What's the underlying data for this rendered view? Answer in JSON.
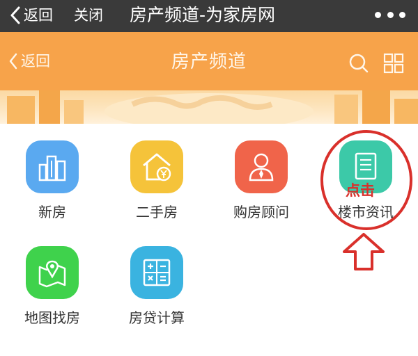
{
  "topbar": {
    "back_label": "返回",
    "close_label": "关闭",
    "title": "房产频道-为家房网",
    "more_icon": "more-dots-icon"
  },
  "header": {
    "back_label": "返回",
    "title": "房产频道",
    "search_icon": "search-icon",
    "grid_icon": "grid-icon",
    "color": "#f7a34a"
  },
  "tiles": [
    {
      "label": "新房",
      "icon": "buildings-icon",
      "color": "#5aa9f0"
    },
    {
      "label": "二手房",
      "icon": "house-yuan-icon",
      "color": "#f5c33a"
    },
    {
      "label": "购房顾问",
      "icon": "advisor-icon",
      "color": "#f0644a"
    },
    {
      "label": "楼市资讯",
      "icon": "document-icon",
      "color": "#3cc9a8"
    },
    {
      "label": "地图找房",
      "icon": "map-pin-icon",
      "color": "#3fd24c"
    },
    {
      "label": "房贷计算",
      "icon": "calculator-icon",
      "color": "#3ab3e0"
    }
  ],
  "annotation": {
    "text": "点击",
    "color": "#d9302b"
  }
}
